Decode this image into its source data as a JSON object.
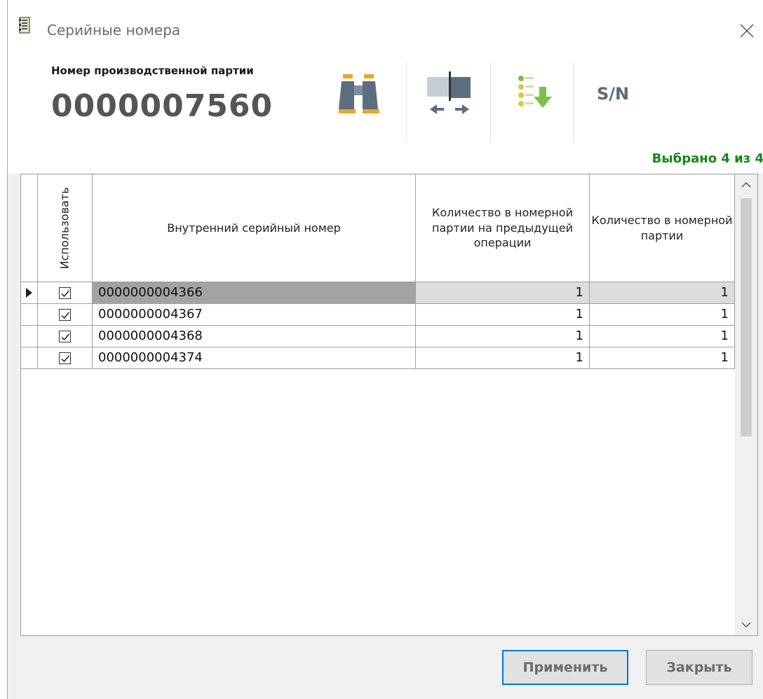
{
  "window": {
    "title": "Серийные номера",
    "icon": "list-document-icon",
    "close_icon": "close-icon"
  },
  "header": {
    "batch_label": "Номер производственной партии",
    "batch_number": "0000007560",
    "selected_info": "Выбрано 4 из 4",
    "selected_color": "#128a12"
  },
  "toolbar": {
    "find_icon": "binoculars-icon",
    "move_icon": "transfer-arrows-icon",
    "fill_icon": "list-download-icon",
    "sn_label": "S/N"
  },
  "grid": {
    "columns": {
      "use": "Использовать",
      "serial": "Внутренний серийный номер",
      "prev_qty": "Количество в номерной партии на предыдущей операции",
      "qty": "Количество в номерной партии"
    },
    "rows": [
      {
        "checked": true,
        "serial": "0000000004366",
        "prev_qty": "1",
        "qty": "1",
        "current": true
      },
      {
        "checked": true,
        "serial": "0000000004367",
        "prev_qty": "1",
        "qty": "1",
        "current": false
      },
      {
        "checked": true,
        "serial": "0000000004368",
        "prev_qty": "1",
        "qty": "1",
        "current": false
      },
      {
        "checked": true,
        "serial": "0000000004374",
        "prev_qty": "1",
        "qty": "1",
        "current": false
      }
    ]
  },
  "buttons": {
    "apply": "Применить",
    "close": "Закрыть"
  },
  "colors": {
    "accent": "#0078d7",
    "current_row_cell": "#a3a3a3"
  }
}
